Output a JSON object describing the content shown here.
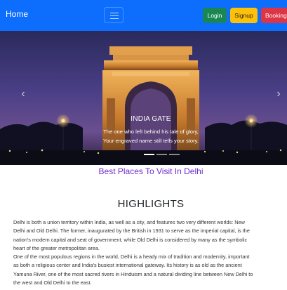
{
  "navbar": {
    "brand": "Home",
    "toggler_icon": "hamburger-icon",
    "buttons": {
      "login": "Login",
      "signup": "Signup",
      "booking": "Booking"
    },
    "colors": {
      "navbar": "#0d6efd",
      "login": "#198754",
      "signup": "#ffc107",
      "booking": "#dc3545"
    }
  },
  "carousel": {
    "caption_title": "INDIA GATE",
    "caption_line1": "The one who left behind his tale of glory,",
    "caption_line2": "Your engraved name still tells your story.",
    "prev_icon": "chevron-left-icon",
    "next_icon": "chevron-right-icon",
    "indicator_count": 3,
    "active_indicator": 1
  },
  "main": {
    "subtitle": "Best Places To Visit In Delhi",
    "heading": "HIGHLIGHTS",
    "paragraph1_lines": [
      "Delhi is both a union territory within India, as well as a city, and features two very different worlds: New",
      "Delhi and Old Delhi. The former, inaugurated by the British in 1931 to serve as the imperial capital, is the",
      "nation's modern capital and seat of government, while Old Delhi is considered by many as the symbolic",
      "heart of the greater metropolitan area."
    ],
    "paragraph2_lines": [
      "One of the most populous regions in the world, Delhi is a heady mix of tradition and modernity, important",
      "as both a religious center and India's busiest international gateway. Its history is as old as the ancient",
      "Yamuna River, one of the most sacred rivers in Hinduism and a natural dividing line between New Delhi to",
      "the west and Old Delhi to the east."
    ]
  }
}
